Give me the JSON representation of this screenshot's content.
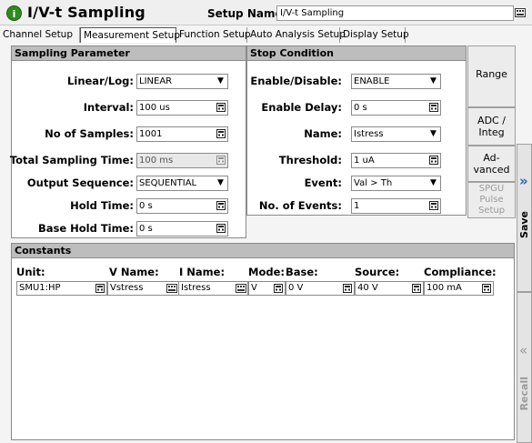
{
  "app": {
    "title": "I/V-t Sampling",
    "setup_name_label": "Setup Name:",
    "setup_name_value": "I/V-t Sampling"
  },
  "tabs": [
    "Channel Setup",
    "Measurement Setup",
    "Function Setup",
    "Auto Analysis Setup",
    "Display Setup"
  ],
  "active_tab": "Measurement Setup",
  "sampling": {
    "header": "Sampling Parameter",
    "linear_log": {
      "label": "Linear/Log:",
      "value": "LINEAR"
    },
    "interval": {
      "label": "Interval:",
      "value": "100 us"
    },
    "samples": {
      "label": "No of Samples:",
      "value": "1001"
    },
    "total_time": {
      "label": "Total Sampling Time:",
      "value": "100 ms"
    },
    "output_seq": {
      "label": "Output Sequence:",
      "value": "SEQUENTIAL"
    },
    "hold_time": {
      "label": "Hold Time:",
      "value": "0 s"
    },
    "base_hold_time": {
      "label": "Base Hold Time:",
      "value": "0 s"
    }
  },
  "stop": {
    "header": "Stop Condition",
    "enable": {
      "label": "Enable/Disable:",
      "value": "ENABLE"
    },
    "enable_delay": {
      "label": "Enable Delay:",
      "value": "0 s"
    },
    "name": {
      "label": "Name:",
      "value": "Istress"
    },
    "threshold": {
      "label": "Threshold:",
      "value": "1 uA"
    },
    "event": {
      "label": "Event:",
      "value": "Val > Th"
    },
    "num_events": {
      "label": "No. of Events:",
      "value": "1"
    }
  },
  "side_buttons": {
    "range": "Range",
    "adc": [
      "ADC /",
      "Integ"
    ],
    "advanced": [
      "Ad-",
      "vanced"
    ],
    "spgu": [
      "SPGU",
      "Pulse",
      "Setup"
    ]
  },
  "constants": {
    "header": "Constants",
    "columns": {
      "unit": "Unit:",
      "vname": "V Name:",
      "iname": "I Name:",
      "mode": "Mode:",
      "base": "Base:",
      "source": "Source:",
      "compliance": "Compliance:"
    },
    "row": {
      "unit": "SMU1:HP",
      "vname": "Vstress",
      "iname": "Istress",
      "mode": "V",
      "base": "0 V",
      "source": "40 V",
      "compliance": "100 mA"
    }
  },
  "right_rail": {
    "save": "Save",
    "recall": "Recall",
    "expand_glyph": "»",
    "collapse_glyph": "«"
  },
  "colors": {
    "accent_green": "#2e8b1e",
    "header_gray": "#bdbdbd",
    "rail_blue": "#2f5fb0"
  }
}
